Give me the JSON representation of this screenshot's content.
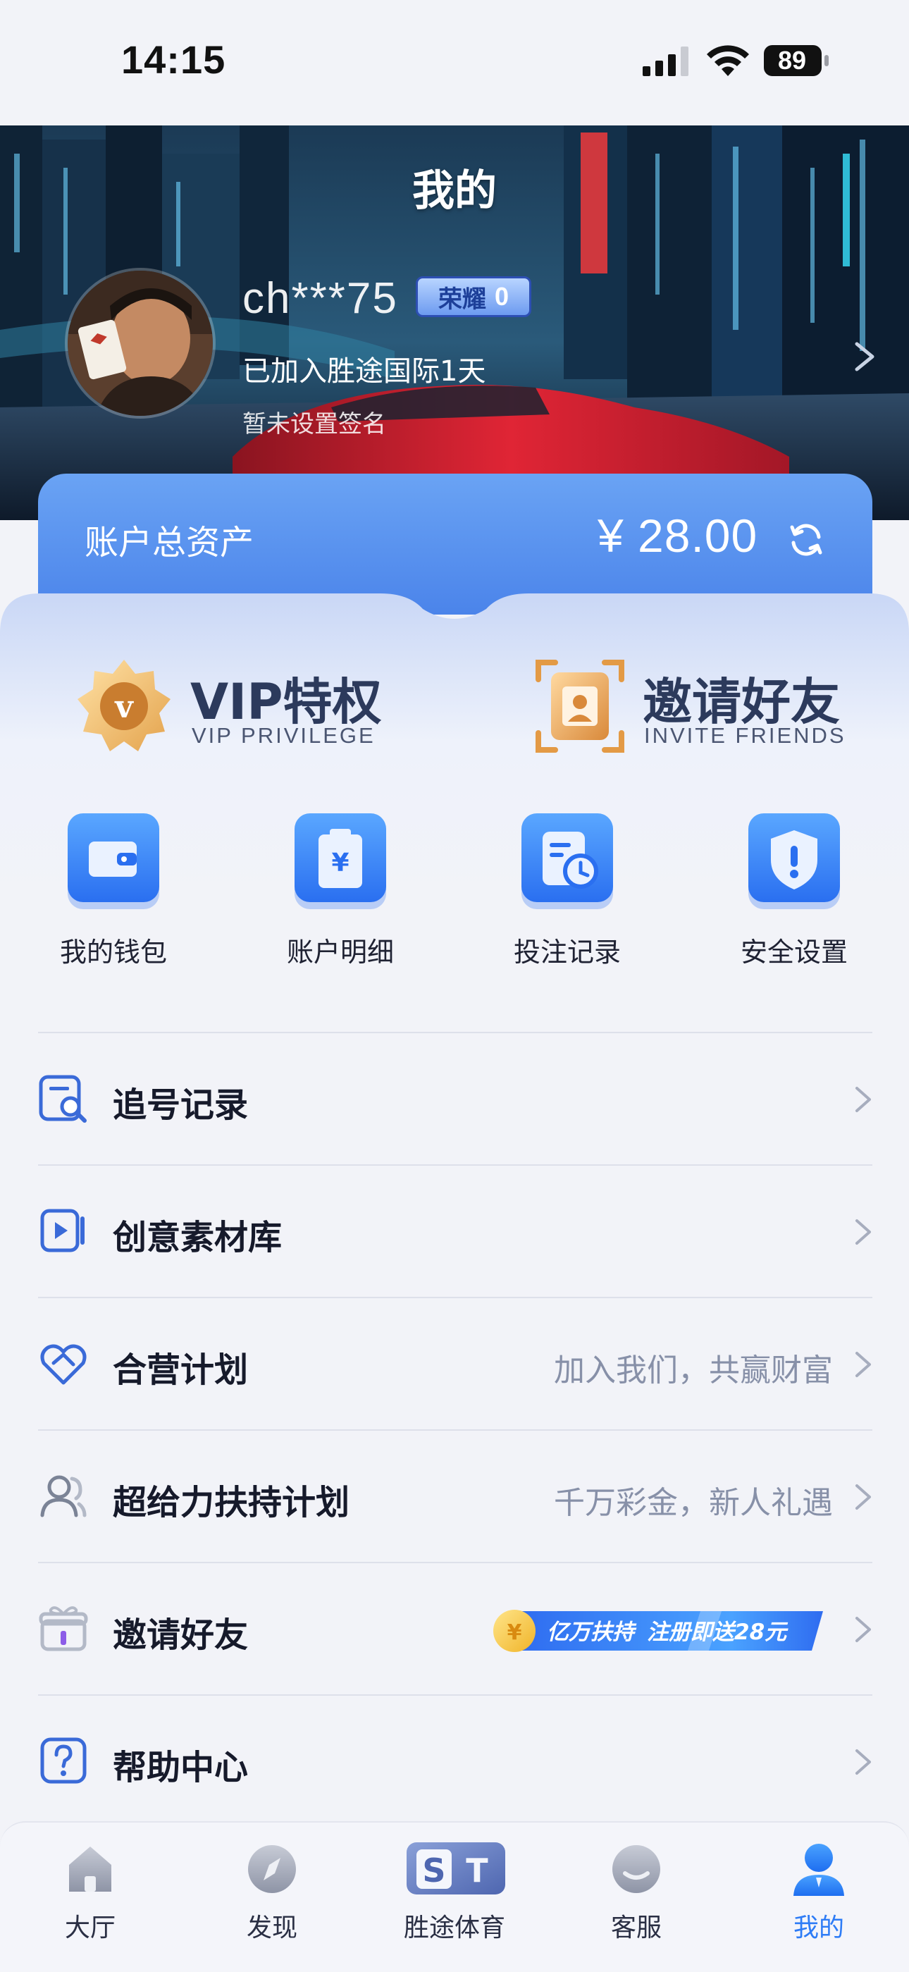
{
  "status_bar": {
    "time": "14:15",
    "battery": "89"
  },
  "header": {
    "title": "我的"
  },
  "profile": {
    "username": "ch***75",
    "rank_label": "荣耀",
    "rank_value": "0",
    "joined_text": "已加入胜途国际1天",
    "signature_text": "暂未设置签名"
  },
  "assets": {
    "label": "账户总资产",
    "value": "¥ 28.00"
  },
  "features": {
    "vip_title": "VIP特权",
    "vip_subtitle": "VIP PRIVILEGE",
    "invite_title": "邀请好友",
    "invite_subtitle": "INVITE FRIENDS"
  },
  "quick_actions": [
    {
      "label": "我的钱包",
      "icon": "wallet-icon"
    },
    {
      "label": "账户明细",
      "icon": "account-detail-icon"
    },
    {
      "label": "投注记录",
      "icon": "bet-record-icon"
    },
    {
      "label": "安全设置",
      "icon": "security-icon"
    }
  ],
  "menu": [
    {
      "label": "追号记录",
      "hint": "",
      "icon": "chase-record-icon"
    },
    {
      "label": "创意素材库",
      "hint": "",
      "icon": "media-library-icon"
    },
    {
      "label": "合营计划",
      "hint": "加入我们，共赢财富",
      "icon": "partnership-icon"
    },
    {
      "label": "超给力扶持计划",
      "hint": "千万彩金，新人礼遇",
      "icon": "support-plan-icon"
    },
    {
      "label": "邀请好友",
      "hint": "",
      "icon": "gift-icon"
    },
    {
      "label": "帮助中心",
      "hint": "",
      "icon": "help-icon"
    }
  ],
  "invite_banner": {
    "coin_symbol": "¥",
    "text_a": "亿万扶持",
    "text_b": "注册即送28元"
  },
  "tabs": [
    {
      "label": "大厅",
      "icon": "home-icon"
    },
    {
      "label": "发现",
      "icon": "compass-icon"
    },
    {
      "label": "胜途体育",
      "icon": "st-logo-icon",
      "logo_s": "S",
      "logo_t": "T"
    },
    {
      "label": "客服",
      "icon": "support-icon"
    },
    {
      "label": "我的",
      "icon": "profile-icon",
      "active": true
    }
  ],
  "colors": {
    "accent": "#2d7cf6",
    "asset_card": "#4b84ea",
    "title_dark": "#2c3a5c"
  }
}
